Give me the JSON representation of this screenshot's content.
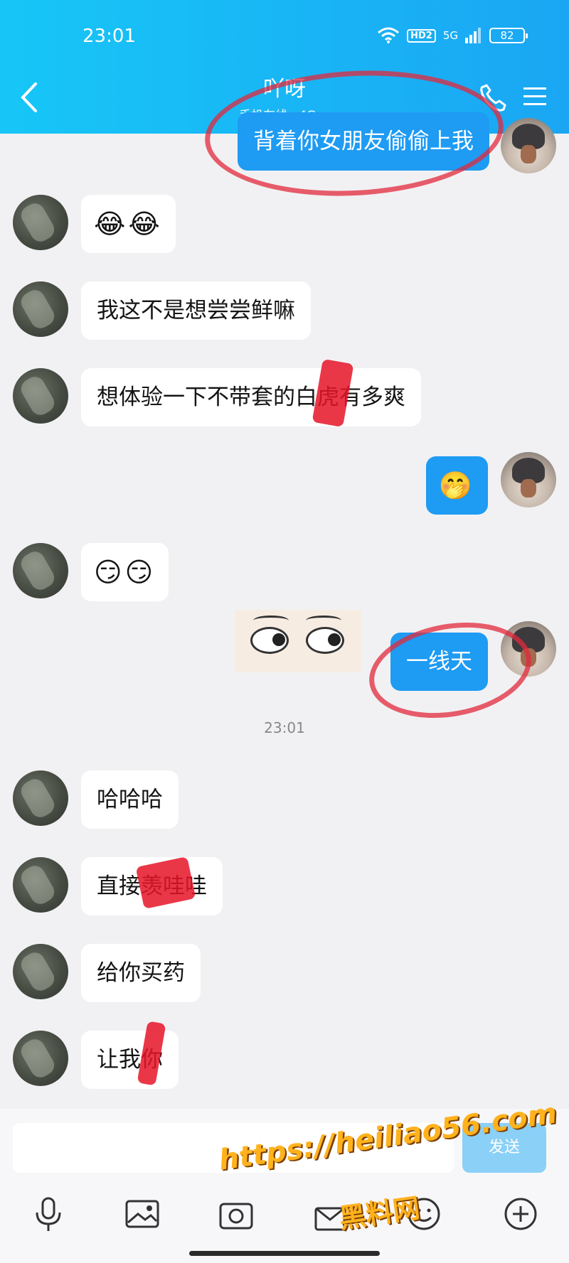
{
  "status_bar": {
    "time": "23:01",
    "hd_label": "HD2",
    "network_label": "5G",
    "battery": "82"
  },
  "header": {
    "name": "吖呀",
    "status": "手机在线 · 4G >"
  },
  "messages": [
    {
      "side": "self",
      "text": "背着你女朋友偷偷上我"
    },
    {
      "side": "peer",
      "text": "😂😂"
    },
    {
      "side": "peer",
      "text": "我这不是想尝尝鲜嘛"
    },
    {
      "side": "peer",
      "text": "想体验一下不带套的白虎有多爽"
    },
    {
      "side": "self",
      "text": "🤭"
    },
    {
      "side": "peer",
      "text": "😏😏"
    },
    {
      "side": "self",
      "text": "一线天"
    },
    {
      "side": "peer",
      "text": "哈哈哈"
    },
    {
      "side": "peer",
      "text": "直接羡哇哇"
    },
    {
      "side": "peer",
      "text": "给你买药"
    },
    {
      "side": "peer",
      "text": "让我你"
    }
  ],
  "time_divider": "23:01",
  "input": {
    "send_label": "发送"
  },
  "toolbar": {
    "icons": [
      "mic-icon",
      "image-icon",
      "camera-icon",
      "gift-icon",
      "emoji-icon",
      "plus-icon"
    ]
  },
  "watermark": {
    "url": "https://heiliao56.com",
    "name": "黑料网"
  },
  "colors": {
    "header": "#1aa6f3",
    "self_bubble": "#1e9bf3",
    "peer_bubble": "#ffffff",
    "annotation": "#e2283c"
  }
}
